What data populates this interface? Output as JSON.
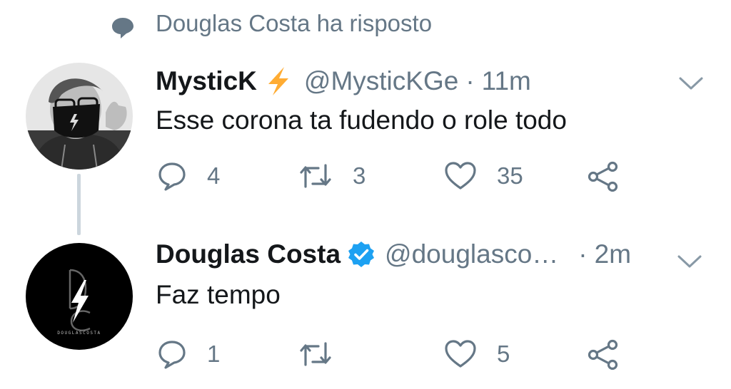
{
  "context": {
    "icon": "speech-bubble-icon",
    "text": "Douglas Costa ha risposto"
  },
  "tweets": [
    {
      "name": "MysticK",
      "badge": "lightning-icon",
      "handle": "@MysticKGe",
      "separator": "·",
      "time": "11m",
      "text": "Esse corona ta fudendo o role todo",
      "replies": "4",
      "retweets": "3",
      "likes": "35"
    },
    {
      "name": "Douglas Costa",
      "badge": "verified-icon",
      "handle": "@douglasco…",
      "separator": "·",
      "time": "2m",
      "text": "Faz tempo",
      "replies": "1",
      "retweets": "",
      "likes": "5"
    }
  ],
  "colors": {
    "secondary": "#657786",
    "primary_text": "#14171a",
    "verified": "#1da1f2",
    "lightning": "#ffac33",
    "thread_line": "#ccd6dd"
  }
}
